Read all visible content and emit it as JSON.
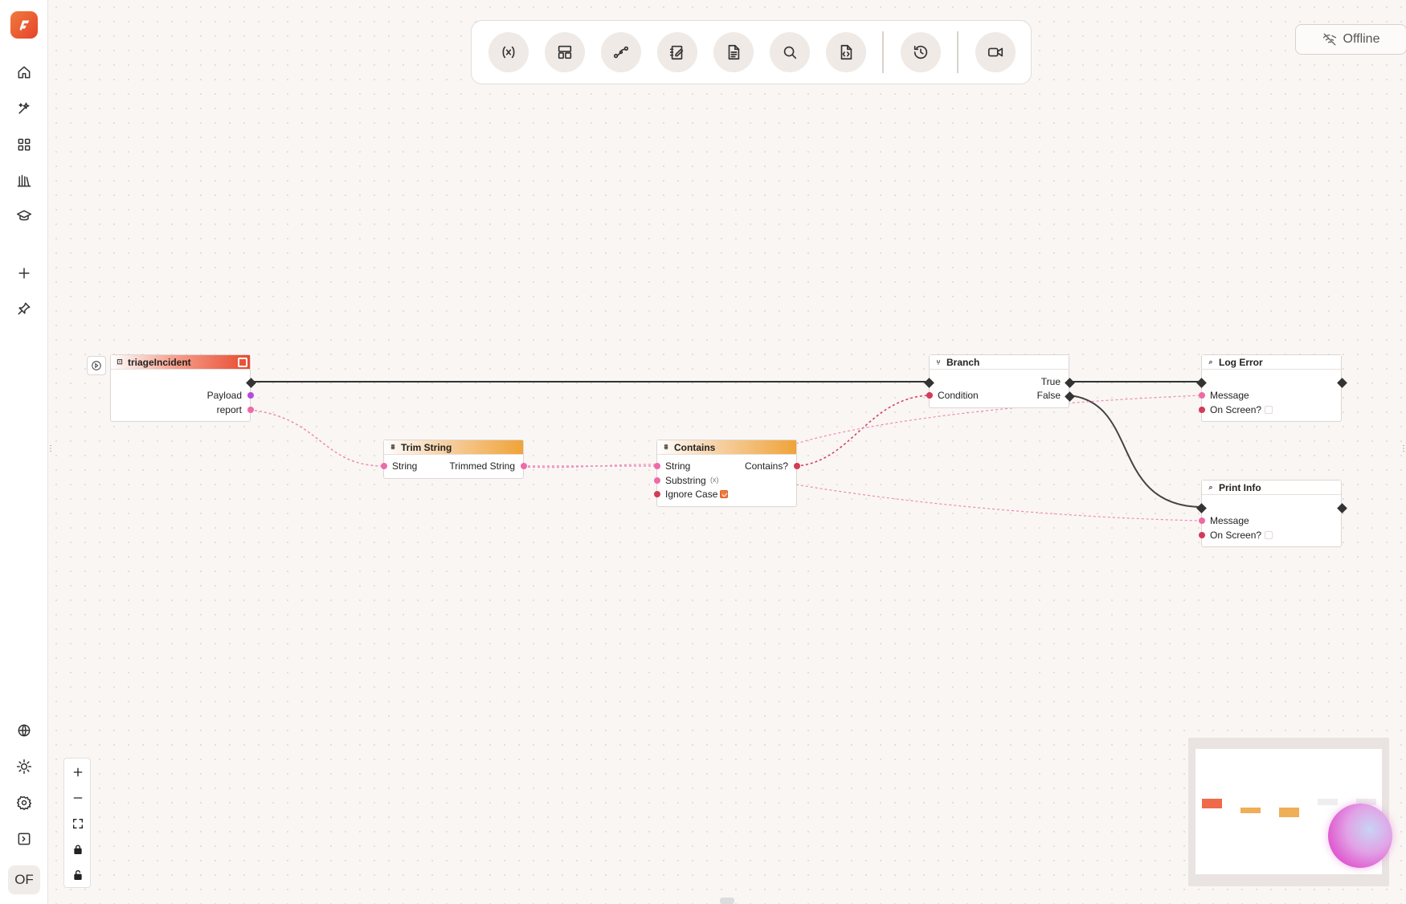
{
  "app": {
    "avatar_text": "OF"
  },
  "sidebar": {
    "top_items": [
      "home-icon",
      "sparkles-icon",
      "grid-icon",
      "library-icon",
      "graduation-cap-icon",
      "plus-icon",
      "pin-icon"
    ],
    "bottom_items": [
      "globe-icon",
      "sun-icon",
      "settings-icon",
      "panel-toggle-icon"
    ]
  },
  "toolbar": {
    "tools": [
      "variables-icon",
      "layout-icon",
      "connections-icon",
      "edit-notes-icon",
      "document-icon",
      "search-icon",
      "code-file-icon",
      "history-icon",
      "video-icon"
    ]
  },
  "status": {
    "offline_label": "Offline"
  },
  "nodes": {
    "triage": {
      "title": "triageIncident",
      "out_payload": "Payload",
      "out_report": "report"
    },
    "trim": {
      "title": "Trim String",
      "in_string": "String",
      "out_trimmed": "Trimmed String"
    },
    "contains": {
      "title": "Contains",
      "in_string": "String",
      "in_substring": "Substring",
      "in_ignore_case": "Ignore Case",
      "out_contains": "Contains?",
      "ignore_case_checked": true
    },
    "branch": {
      "title": "Branch",
      "in_condition": "Condition",
      "out_true": "True",
      "out_false": "False"
    },
    "log_error": {
      "title": "Log Error",
      "in_message": "Message",
      "in_on_screen": "On Screen?"
    },
    "print_info": {
      "title": "Print Info",
      "in_message": "Message",
      "in_on_screen": "On Screen?"
    }
  },
  "colors": {
    "accent_red": "#e84a2f",
    "accent_orange": "#f0a338",
    "pin_pink": "#ee6aa8",
    "pin_red": "#d23c57",
    "exec_wire": "#333333"
  }
}
